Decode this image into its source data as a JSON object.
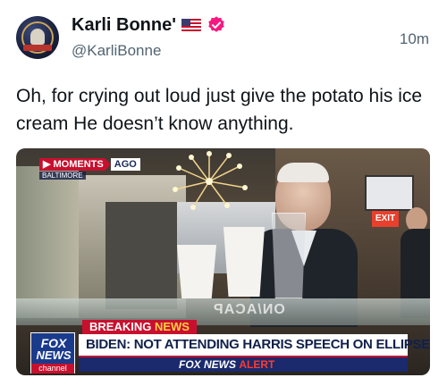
{
  "author": {
    "display_name": "Karli Bonne'",
    "handle": "@KarliBonne",
    "flag_icon": "us-flag-icon",
    "verified_icon": "verified-badge-icon",
    "verified_color": "#f91880"
  },
  "post": {
    "timestamp": "10m",
    "text": "Oh, for crying out loud just give the potato his ice cream He doesn’t know anything."
  },
  "media": {
    "moments_label": "▶ MOMENTS",
    "moments_ago": "AGO",
    "location": "BALTIMORE",
    "exit_sign": "EXIT",
    "counter_text": "ON/ACAP",
    "breaking_label": "BREAKING",
    "breaking_news": "NEWS",
    "headline": "BIDEN: NOT ATTENDING HARRIS SPEECH ON ELLIPSE",
    "alert_brand": "FOX NEWS",
    "alert_word": "ALERT",
    "logo_line1": "FOX",
    "logo_line2": "NEWS",
    "logo_line3": "channel",
    "accent_red": "#c8102e",
    "accent_navy": "#1a2a6c"
  }
}
